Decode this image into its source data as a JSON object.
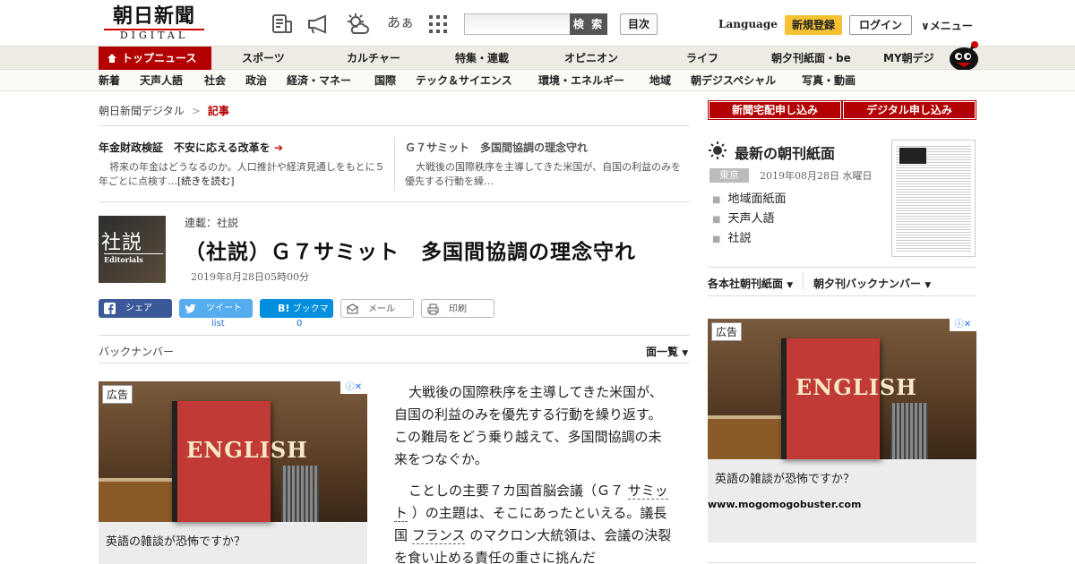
{
  "header": {
    "logo_jp": "朝日新聞",
    "logo_en": "DIGITAL",
    "icons": [
      "newspaper-icon",
      "megaphone-icon",
      "weather-icon",
      "font-size-icon",
      "grid-menu-icon"
    ],
    "font_size_label": "あぁ",
    "search_placeholder": "",
    "search_label": "検 索",
    "toc_label": "目次",
    "language_label": "Language",
    "register_label": "新規登録",
    "login_label": "ログイン",
    "menu_label": "メニュー"
  },
  "nav_primary": {
    "top_label": "トップニュース",
    "items": [
      "スポーツ",
      "カルチャー",
      "特集・連載",
      "オピニオン",
      "ライフ",
      "朝夕刊紙面・be",
      "MY朝デジ"
    ]
  },
  "nav_secondary": {
    "items": [
      "新着",
      "天声人語",
      "社会",
      "政治",
      "経済・マネー",
      "国際",
      "テック＆サイエンス",
      "環境・エネルギー",
      "地域",
      "朝デジスペシャル",
      "写真・動画"
    ]
  },
  "breadcrumb": {
    "home": "朝日新聞デジタル",
    "current": "記事"
  },
  "teasers": [
    {
      "title": "年金財政検証　不安に応える改革を",
      "body": "将来の年金はどうなるのか。人口推計や経済見通しをもとに５年ごとに点検す…",
      "more": "[続きを読む]"
    },
    {
      "title": "Ｇ７サミット　多国間協調の理念守れ",
      "body": "大戦後の国際秩序を主導してきた米国が、自国の利益のみを優先する行動を繰…",
      "more": ""
    }
  ],
  "article": {
    "thumb_jp": "社説",
    "thumb_en": "Editorials",
    "series": "連載：社説",
    "headline": "（社説）Ｇ７サミット　多国間協調の理念守れ",
    "date": "2019年8月28日05時00分",
    "paragraph1": "大戦後の国際秩序を主導してきた米国が、自国の利益のみを優先する行動を繰り返す。この難局をどう乗り越えて、多国間協調の未来をつなぐか。",
    "p2_a": "ことしの主要７カ国首脳会議（Ｇ７ ",
    "p2_link1": "サミット",
    "p2_b": " ）の主題は、そこにあったといえる。議長国 ",
    "p2_link2": "フランス",
    "p2_c": " のマクロン大統領は、会議の決裂を食い止める責任の重さに挑んだ"
  },
  "share": {
    "facebook": "シェア",
    "twitter": "ツイート",
    "twitter_count": "list",
    "hatena": "ブックマーク",
    "hatena_count": "0",
    "mail": "メール",
    "print": "印刷"
  },
  "backnumber": {
    "label": "バックナンバー",
    "dropdown": "面一覧"
  },
  "ads": {
    "tag": "広告",
    "book_text": "ENGLISH",
    "caption": "英語の雑談が恐怖ですか？",
    "url": "www.mogomogobuster.com"
  },
  "sidebar": {
    "subscribe_paper": "新聞宅配申し込み",
    "subscribe_digital": "デジタル申し込み",
    "latest_title": "最新の朝刊紙面",
    "region": "東京",
    "paper_date": "2019年08月28日 水曜日",
    "links": [
      "地域面紙面",
      "天声人語",
      "社説"
    ],
    "dropdown1": "各本社朝刊紙面",
    "dropdown2": "朝夕刊バックナンバー"
  },
  "colors": {
    "accent_red": "#b30000",
    "register_yellow": "#f5c233",
    "facebook": "#3b5998",
    "twitter": "#55acee",
    "hatena": "#008fde"
  }
}
